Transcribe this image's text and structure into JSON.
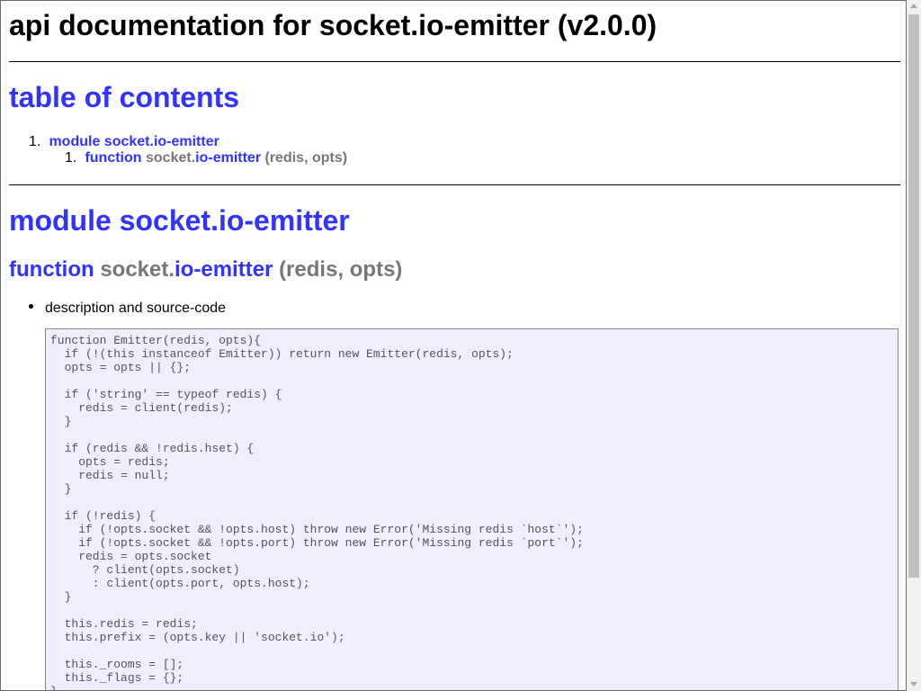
{
  "page": {
    "title": "api documentation for socket.io-emitter (v2.0.0)"
  },
  "toc": {
    "heading": "table of contents",
    "items": [
      {
        "number": "1.",
        "keyword": "module",
        "name": "socket.io-emitter",
        "children": [
          {
            "number": "1.",
            "keyword": "function",
            "prefix": "socket.",
            "name": "io-emitter",
            "args": "(redis, opts)"
          }
        ]
      }
    ]
  },
  "module_section": {
    "heading_keyword": "module",
    "heading_name": "socket.io-emitter",
    "function": {
      "keyword": "function",
      "prefix": "socket.",
      "name": "io-emitter",
      "args": "(redis, opts)"
    },
    "bullet_label": "description and source-code",
    "source_code": "function Emitter(redis, opts){\n  if (!(this instanceof Emitter)) return new Emitter(redis, opts);\n  opts = opts || {};\n\n  if ('string' == typeof redis) {\n    redis = client(redis);\n  }\n\n  if (redis && !redis.hset) {\n    opts = redis;\n    redis = null;\n  }\n\n  if (!redis) {\n    if (!opts.socket && !opts.host) throw new Error('Missing redis `host`');\n    if (!opts.socket && !opts.port) throw new Error('Missing redis `port`');\n    redis = opts.socket\n      ? client(opts.socket)\n      : client(opts.port, opts.host);\n  }\n\n  this.redis = redis;\n  this.prefix = (opts.key || 'socket.io');\n\n  this._rooms = [];\n  this._flags = {};\n}"
  },
  "colors": {
    "link": "#3333ff",
    "muted": "#777777",
    "code_background": "#eeeeff"
  }
}
